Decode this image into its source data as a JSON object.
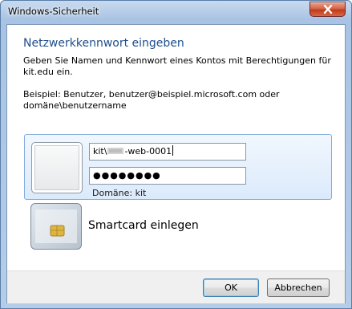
{
  "window": {
    "title": "Windows-Sicherheit"
  },
  "dialog": {
    "heading": "Netzwerkkennwort eingeben",
    "description": "Geben Sie Namen und Kennwort eines Kontos mit Berechtigungen für kit.edu ein.",
    "example": "Beispiel: Benutzer, benutzer@beispiel.microsoft.com oder domäne\\benutzername"
  },
  "credential": {
    "username_prefix": "kit\\",
    "username_suffix": "-web-0001",
    "password_mask": "●●●●●●●●",
    "domain_label": "Domäne: kit"
  },
  "smartcard": {
    "label": "Smartcard einlegen"
  },
  "buttons": {
    "ok": "OK",
    "cancel": "Abbrechen"
  },
  "colors": {
    "heading": "#1e4e8c",
    "tile_border": "#84acdd",
    "close": "#c23a1c"
  }
}
